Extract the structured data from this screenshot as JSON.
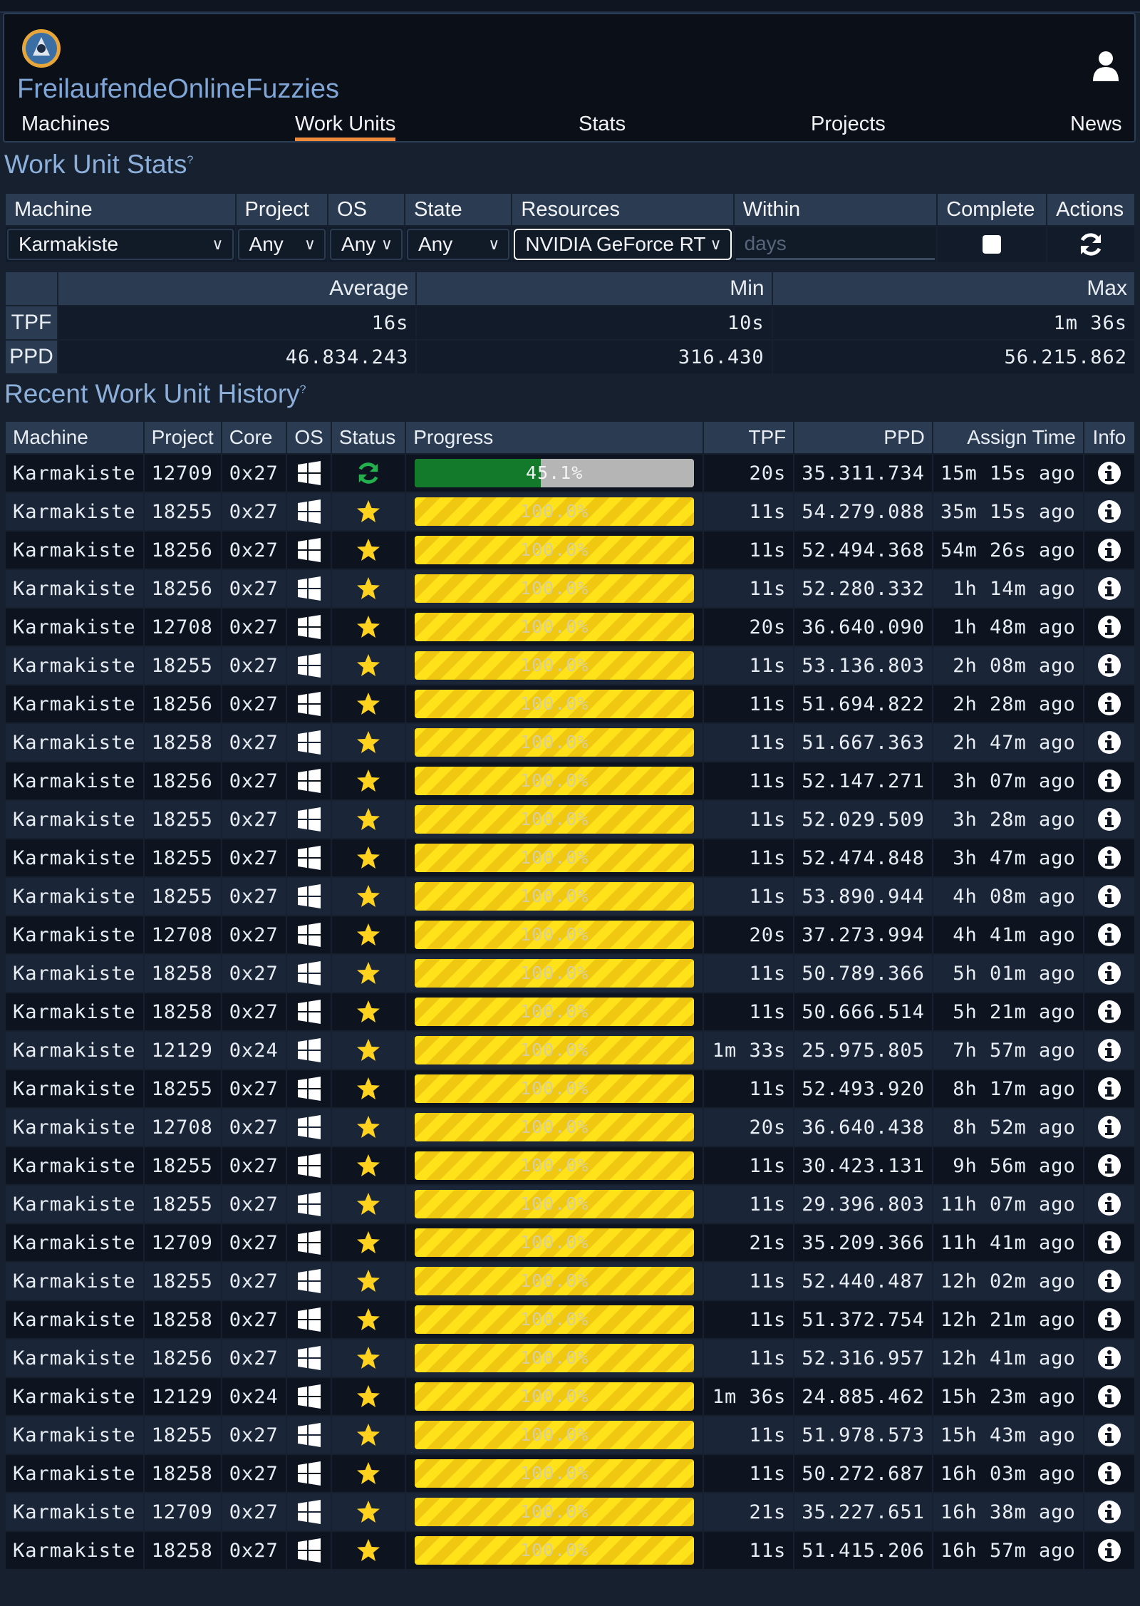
{
  "header": {
    "team_name": "FreilaufendeOnlineFuzzies",
    "nav": [
      "Machines",
      "Work Units",
      "Stats",
      "Projects",
      "News"
    ],
    "active_nav": "Work Units"
  },
  "filters": {
    "title": "Work Unit Stats",
    "help": "?",
    "columns": [
      "Machine",
      "Project",
      "OS",
      "State",
      "Resources",
      "Within",
      "Complete",
      "Actions"
    ],
    "machine": "Karmakiste",
    "project": "Any",
    "os": "Any",
    "state": "Any",
    "resources": "NVIDIA GeForce RT",
    "within_placeholder": "days",
    "complete_checked": false
  },
  "summary": {
    "columns": [
      "Average",
      "Min",
      "Max"
    ],
    "rows": [
      {
        "label": "TPF",
        "avg": "16s",
        "min": "10s",
        "max": "1m 36s"
      },
      {
        "label": "PPD",
        "avg": "46.834.243",
        "min": "316.430",
        "max": "56.215.862"
      }
    ]
  },
  "history": {
    "title": "Recent Work Unit History",
    "help": "?",
    "columns": [
      "Machine",
      "Project",
      "Core",
      "OS",
      "Status",
      "Progress",
      "TPF",
      "PPD",
      "Assign Time",
      "Info"
    ],
    "rows": [
      {
        "machine": "Karmakiste",
        "project": "12709",
        "core": "0x27",
        "status": "running",
        "progress": "45.1%",
        "tpf": "20s",
        "ppd": "35.311.734",
        "assign": "15m 15s ago"
      },
      {
        "machine": "Karmakiste",
        "project": "18255",
        "core": "0x27",
        "status": "finished",
        "progress": "100.0%",
        "tpf": "11s",
        "ppd": "54.279.088",
        "assign": "35m 15s ago"
      },
      {
        "machine": "Karmakiste",
        "project": "18256",
        "core": "0x27",
        "status": "finished",
        "progress": "100.0%",
        "tpf": "11s",
        "ppd": "52.494.368",
        "assign": "54m 26s ago"
      },
      {
        "machine": "Karmakiste",
        "project": "18256",
        "core": "0x27",
        "status": "finished",
        "progress": "100.0%",
        "tpf": "11s",
        "ppd": "52.280.332",
        "assign": "1h 14m ago"
      },
      {
        "machine": "Karmakiste",
        "project": "12708",
        "core": "0x27",
        "status": "finished",
        "progress": "100.0%",
        "tpf": "20s",
        "ppd": "36.640.090",
        "assign": "1h 48m ago"
      },
      {
        "machine": "Karmakiste",
        "project": "18255",
        "core": "0x27",
        "status": "finished",
        "progress": "100.0%",
        "tpf": "11s",
        "ppd": "53.136.803",
        "assign": "2h 08m ago"
      },
      {
        "machine": "Karmakiste",
        "project": "18256",
        "core": "0x27",
        "status": "finished",
        "progress": "100.0%",
        "tpf": "11s",
        "ppd": "51.694.822",
        "assign": "2h 28m ago"
      },
      {
        "machine": "Karmakiste",
        "project": "18258",
        "core": "0x27",
        "status": "finished",
        "progress": "100.0%",
        "tpf": "11s",
        "ppd": "51.667.363",
        "assign": "2h 47m ago"
      },
      {
        "machine": "Karmakiste",
        "project": "18256",
        "core": "0x27",
        "status": "finished",
        "progress": "100.0%",
        "tpf": "11s",
        "ppd": "52.147.271",
        "assign": "3h 07m ago"
      },
      {
        "machine": "Karmakiste",
        "project": "18255",
        "core": "0x27",
        "status": "finished",
        "progress": "100.0%",
        "tpf": "11s",
        "ppd": "52.029.509",
        "assign": "3h 28m ago"
      },
      {
        "machine": "Karmakiste",
        "project": "18255",
        "core": "0x27",
        "status": "finished",
        "progress": "100.0%",
        "tpf": "11s",
        "ppd": "52.474.848",
        "assign": "3h 47m ago"
      },
      {
        "machine": "Karmakiste",
        "project": "18255",
        "core": "0x27",
        "status": "finished",
        "progress": "100.0%",
        "tpf": "11s",
        "ppd": "53.890.944",
        "assign": "4h 08m ago"
      },
      {
        "machine": "Karmakiste",
        "project": "12708",
        "core": "0x27",
        "status": "finished",
        "progress": "100.0%",
        "tpf": "20s",
        "ppd": "37.273.994",
        "assign": "4h 41m ago"
      },
      {
        "machine": "Karmakiste",
        "project": "18258",
        "core": "0x27",
        "status": "finished",
        "progress": "100.0%",
        "tpf": "11s",
        "ppd": "50.789.366",
        "assign": "5h 01m ago"
      },
      {
        "machine": "Karmakiste",
        "project": "18258",
        "core": "0x27",
        "status": "finished",
        "progress": "100.0%",
        "tpf": "11s",
        "ppd": "50.666.514",
        "assign": "5h 21m ago"
      },
      {
        "machine": "Karmakiste",
        "project": "12129",
        "core": "0x24",
        "status": "finished",
        "progress": "100.0%",
        "tpf": "1m 33s",
        "ppd": "25.975.805",
        "assign": "7h 57m ago"
      },
      {
        "machine": "Karmakiste",
        "project": "18255",
        "core": "0x27",
        "status": "finished",
        "progress": "100.0%",
        "tpf": "11s",
        "ppd": "52.493.920",
        "assign": "8h 17m ago"
      },
      {
        "machine": "Karmakiste",
        "project": "12708",
        "core": "0x27",
        "status": "finished",
        "progress": "100.0%",
        "tpf": "20s",
        "ppd": "36.640.438",
        "assign": "8h 52m ago"
      },
      {
        "machine": "Karmakiste",
        "project": "18255",
        "core": "0x27",
        "status": "finished",
        "progress": "100.0%",
        "tpf": "11s",
        "ppd": "30.423.131",
        "assign": "9h 56m ago"
      },
      {
        "machine": "Karmakiste",
        "project": "18255",
        "core": "0x27",
        "status": "finished",
        "progress": "100.0%",
        "tpf": "11s",
        "ppd": "29.396.803",
        "assign": "11h 07m ago"
      },
      {
        "machine": "Karmakiste",
        "project": "12709",
        "core": "0x27",
        "status": "finished",
        "progress": "100.0%",
        "tpf": "21s",
        "ppd": "35.209.366",
        "assign": "11h 41m ago"
      },
      {
        "machine": "Karmakiste",
        "project": "18255",
        "core": "0x27",
        "status": "finished",
        "progress": "100.0%",
        "tpf": "11s",
        "ppd": "52.440.487",
        "assign": "12h 02m ago"
      },
      {
        "machine": "Karmakiste",
        "project": "18258",
        "core": "0x27",
        "status": "finished",
        "progress": "100.0%",
        "tpf": "11s",
        "ppd": "51.372.754",
        "assign": "12h 21m ago"
      },
      {
        "machine": "Karmakiste",
        "project": "18256",
        "core": "0x27",
        "status": "finished",
        "progress": "100.0%",
        "tpf": "11s",
        "ppd": "52.316.957",
        "assign": "12h 41m ago"
      },
      {
        "machine": "Karmakiste",
        "project": "12129",
        "core": "0x24",
        "status": "finished",
        "progress": "100.0%",
        "tpf": "1m 36s",
        "ppd": "24.885.462",
        "assign": "15h 23m ago"
      },
      {
        "machine": "Karmakiste",
        "project": "18255",
        "core": "0x27",
        "status": "finished",
        "progress": "100.0%",
        "tpf": "11s",
        "ppd": "51.978.573",
        "assign": "15h 43m ago"
      },
      {
        "machine": "Karmakiste",
        "project": "18258",
        "core": "0x27",
        "status": "finished",
        "progress": "100.0%",
        "tpf": "11s",
        "ppd": "50.272.687",
        "assign": "16h 03m ago"
      },
      {
        "machine": "Karmakiste",
        "project": "12709",
        "core": "0x27",
        "status": "finished",
        "progress": "100.0%",
        "tpf": "21s",
        "ppd": "35.227.651",
        "assign": "16h 38m ago"
      },
      {
        "machine": "Karmakiste",
        "project": "18258",
        "core": "0x27",
        "status": "finished",
        "progress": "100.0%",
        "tpf": "11s",
        "ppd": "51.415.206",
        "assign": "16h 57m ago"
      }
    ]
  },
  "icons": {
    "os": "windows-icon",
    "running": "refresh-icon",
    "finished": "star-icon",
    "info": "info-icon",
    "user": "user-icon",
    "actions": "refresh-icon"
  },
  "colors": {
    "accent_tab": "#f08a3c",
    "title_blue": "#8db0db",
    "progress_green": "#137a2c",
    "progress_yellow": "#ffe21a",
    "star_yellow": "#ffd21f",
    "running_green": "#22b14c"
  }
}
